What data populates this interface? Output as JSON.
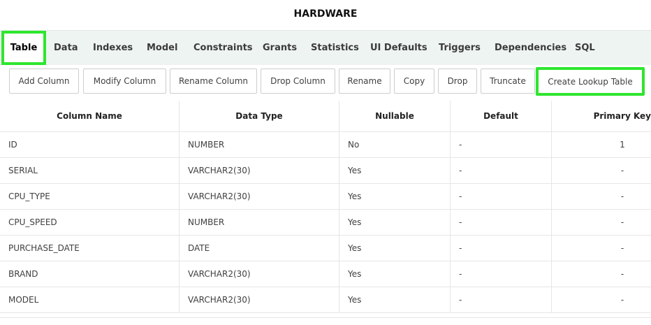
{
  "page": {
    "title": "HARDWARE"
  },
  "tabs": [
    {
      "label": "Table",
      "active": true
    },
    {
      "label": "Data"
    },
    {
      "label": "Indexes"
    },
    {
      "label": "Model"
    },
    {
      "label": "Constraints"
    },
    {
      "label": "Grants"
    },
    {
      "label": "Statistics"
    },
    {
      "label": "UI Defaults"
    },
    {
      "label": "Triggers"
    },
    {
      "label": "Dependencies"
    },
    {
      "label": "SQL"
    }
  ],
  "toolbar": {
    "add_column": "Add Column",
    "modify_column": "Modify Column",
    "rename_column": "Rename Column",
    "drop_column": "Drop Column",
    "rename": "Rename",
    "copy": "Copy",
    "drop": "Drop",
    "truncate": "Truncate",
    "create_lookup_table": "Create Lookup Table"
  },
  "table": {
    "headers": [
      "Column Name",
      "Data Type",
      "Nullable",
      "Default",
      "Primary Key"
    ],
    "rows": [
      [
        "ID",
        "NUMBER",
        "No",
        "-",
        "1"
      ],
      [
        "SERIAL",
        "VARCHAR2(30)",
        "Yes",
        "-",
        "-"
      ],
      [
        "CPU_TYPE",
        "VARCHAR2(30)",
        "Yes",
        "-",
        "-"
      ],
      [
        "CPU_SPEED",
        "NUMBER",
        "Yes",
        "-",
        "-"
      ],
      [
        "PURCHASE_DATE",
        "DATE",
        "Yes",
        "-",
        "-"
      ],
      [
        "BRAND",
        "VARCHAR2(30)",
        "Yes",
        "-",
        "-"
      ],
      [
        "MODEL",
        "VARCHAR2(30)",
        "Yes",
        "-",
        "-"
      ]
    ]
  },
  "colors": {
    "highlight": "#2ee62e",
    "tabbar_bg": "#eef4f1",
    "grid_border": "#e6e6e6"
  }
}
